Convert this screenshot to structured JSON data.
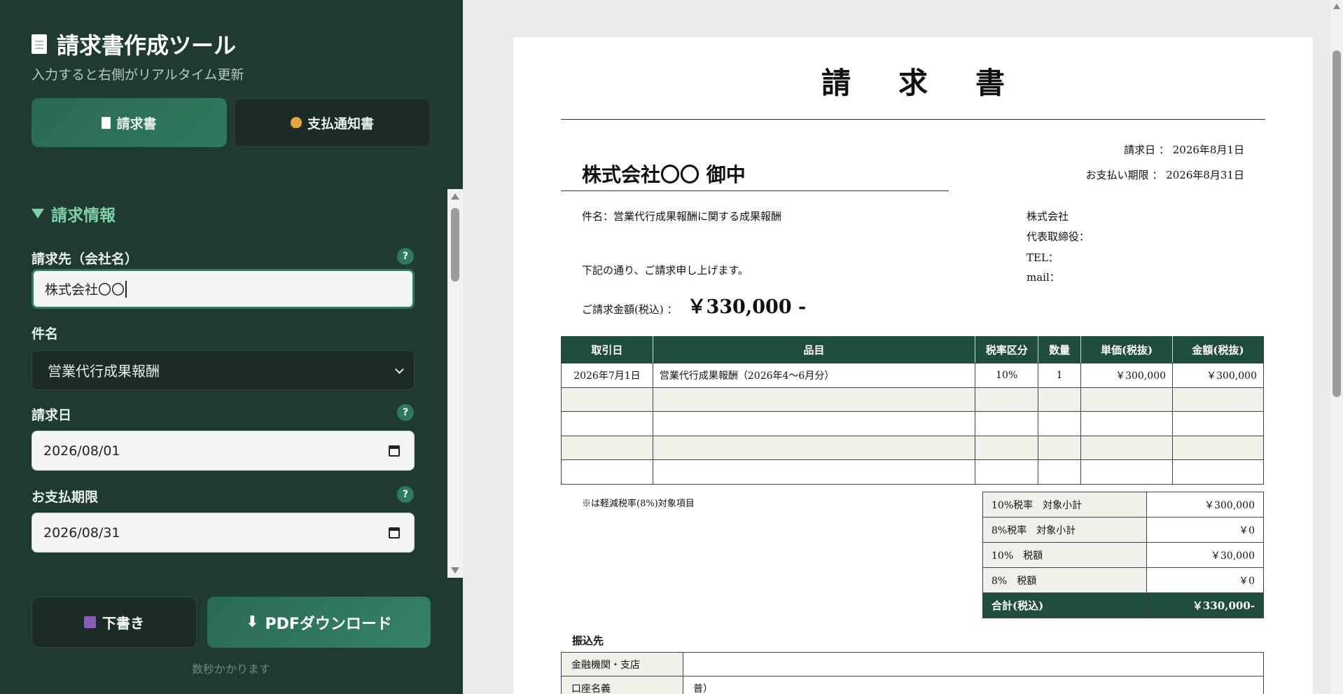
{
  "app": {
    "title": "請求書作成ツール",
    "subtitle": "入力すると右側がリアルタイム更新"
  },
  "tabs": [
    {
      "label": "請求書",
      "active": true,
      "icon": "document-icon"
    },
    {
      "label": "支払通知書",
      "active": false,
      "icon": "money-bag-icon"
    }
  ],
  "form": {
    "section_title": "請求情報",
    "client_label": "請求先（会社名）",
    "client_value": "株式会社〇〇",
    "subject_label": "件名",
    "subject_value": "営業代行成果報酬",
    "issue_date_label": "請求日",
    "issue_date_value": "2026/08/01",
    "due_date_label": "お支払期限",
    "due_date_value": "2026/08/31",
    "help_glyph": "?"
  },
  "actions": {
    "draft_label": "下書き",
    "pdf_label": "PDFダウンロード",
    "note": "数秒かかります"
  },
  "invoice": {
    "title": "請求書",
    "issue_date_label": "請求日",
    "issue_date": "2026年8月1日",
    "due_date_label": "お支払い期限",
    "due_date": "2026年8月31日",
    "client": "株式会社〇〇 御中",
    "subject": "件名：営業代行成果報酬に関する成果報酬",
    "issuer": {
      "company": "株式会社",
      "representative": "代表取締役：",
      "tel": "TEL：",
      "mail": "mail："
    },
    "lead": "下記の通り、ご請求申し上げます。",
    "total_label": "ご請求金額(税込) ：",
    "total_amount": "￥330,000 -",
    "columns": [
      "取引日",
      "品目",
      "税率区分",
      "数量",
      "単価(税抜)",
      "金額(税抜)"
    ],
    "rows": [
      [
        "2026年7月1日",
        "営業代行成果報酬（2026年4〜6月分）",
        "10%",
        "1",
        "￥300,000",
        "￥300,000"
      ],
      [
        "",
        "",
        "",
        "",
        "",
        ""
      ],
      [
        "",
        "",
        "",
        "",
        "",
        ""
      ],
      [
        "",
        "",
        "",
        "",
        "",
        ""
      ],
      [
        "",
        "",
        "",
        "",
        "",
        ""
      ]
    ],
    "footnote": "※は軽減税率(8%)対象項目",
    "summary": [
      {
        "label": "10%税率　対象小計",
        "value": "￥300,000"
      },
      {
        "label": "8%税率　対象小計",
        "value": "￥0"
      },
      {
        "label": "10%　税額",
        "value": "￥30,000"
      },
      {
        "label": "8%　税額",
        "value": "￥0"
      }
    ],
    "grand_total": {
      "label": "合計(税込)",
      "value": "￥330,000-"
    },
    "bank_title": "振込先",
    "bank_rows": [
      {
        "label": "金融機関・支店",
        "value": ""
      },
      {
        "label": "口座名義",
        "value": "普）"
      }
    ]
  },
  "colors": {
    "sidebar_bg": "#1f3b31",
    "accent": "#2f7a5e",
    "section_heading": "#7fd0a6",
    "table_header": "#1f4d3c"
  }
}
